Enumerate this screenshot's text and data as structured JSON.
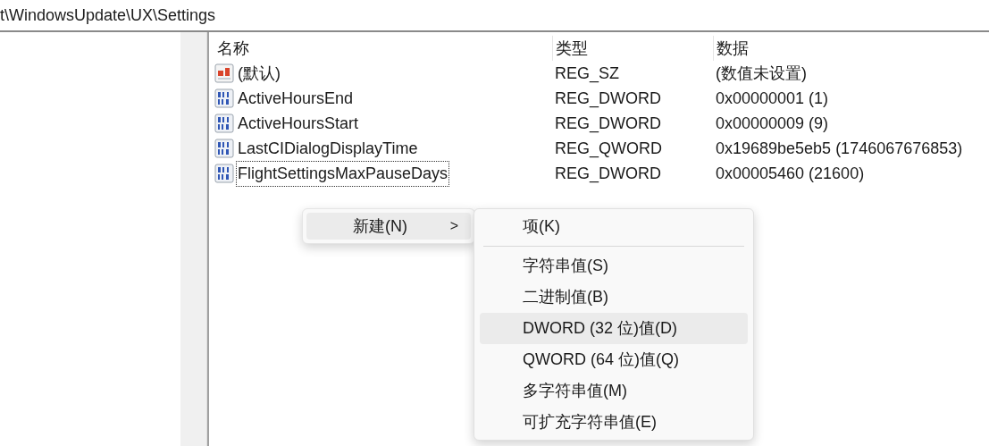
{
  "address_bar": {
    "path": "t\\WindowsUpdate\\UX\\Settings"
  },
  "table": {
    "columns": [
      "名称",
      "类型",
      "数据"
    ],
    "rows": [
      {
        "kind": "string",
        "name": "(默认)",
        "type": "REG_SZ",
        "data": "(数值未设置)",
        "focused": false
      },
      {
        "kind": "binary",
        "name": "ActiveHoursEnd",
        "type": "REG_DWORD",
        "data": "0x00000001 (1)",
        "focused": false
      },
      {
        "kind": "binary",
        "name": "ActiveHoursStart",
        "type": "REG_DWORD",
        "data": "0x00000009 (9)",
        "focused": false
      },
      {
        "kind": "binary",
        "name": "LastCIDialogDisplayTime",
        "type": "REG_QWORD",
        "data": "0x19689be5eb5 (1746067676853)",
        "focused": false
      },
      {
        "kind": "binary",
        "name": "FlightSettingsMaxPauseDays",
        "type": "REG_DWORD",
        "data": "0x00005460 (21600)",
        "focused": true
      }
    ]
  },
  "context_menu": {
    "items": [
      {
        "label": "新建(N)",
        "chevron": ">",
        "selected": true
      }
    ]
  },
  "submenu": {
    "items": [
      {
        "label": "项(K)",
        "selected": false,
        "divider_after": true
      },
      {
        "label": "字符串值(S)",
        "selected": false,
        "divider_after": false
      },
      {
        "label": "二进制值(B)",
        "selected": false,
        "divider_after": false
      },
      {
        "label": "DWORD (32 位)值(D)",
        "selected": true,
        "divider_after": false
      },
      {
        "label": "QWORD (64 位)值(Q)",
        "selected": false,
        "divider_after": false
      },
      {
        "label": "多字符串值(M)",
        "selected": false,
        "divider_after": false
      },
      {
        "label": "可扩充字符串值(E)",
        "selected": false,
        "divider_after": false
      }
    ]
  }
}
